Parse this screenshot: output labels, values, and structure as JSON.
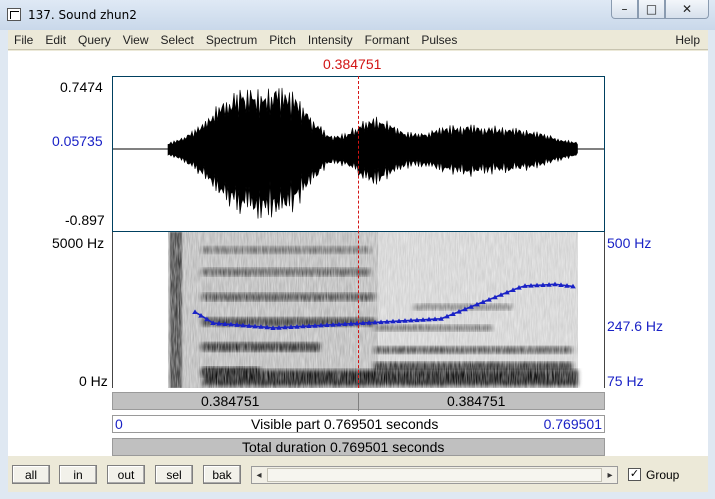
{
  "window": {
    "title": "137. Sound zhun2",
    "min_glyph": "–",
    "max_glyph": "□",
    "close_glyph": "✕"
  },
  "menu": [
    "File",
    "Edit",
    "Query",
    "View",
    "Select",
    "Spectrum",
    "Pitch",
    "Intensity",
    "Formant",
    "Pulses"
  ],
  "help_label": "Help",
  "cursor": {
    "time": "0.384751",
    "time_value": 0.384751
  },
  "waveform": {
    "max_label": "0.7474",
    "cursor_value_label": "0.05735",
    "min_label": "-0.897"
  },
  "spectrogram": {
    "top_label": "5000 Hz",
    "bottom_label": "0 Hz"
  },
  "pitch": {
    "top_label": "500 Hz",
    "mid_label": "247.6 Hz",
    "bottom_label": "75 Hz",
    "color": "#1a22c6"
  },
  "bars": {
    "left_time": "0.384751",
    "right_time": "0.384751",
    "visible_start": "0",
    "visible_text": "Visible part 0.769501 seconds",
    "visible_end": "0.769501",
    "total_text": "Total duration 0.769501 seconds"
  },
  "toolbar": {
    "buttons": [
      "all",
      "in",
      "out",
      "sel",
      "bak"
    ],
    "scroll_left": "◂",
    "scroll_right": "▸",
    "group_label": "Group",
    "group_checked": "✓"
  }
}
